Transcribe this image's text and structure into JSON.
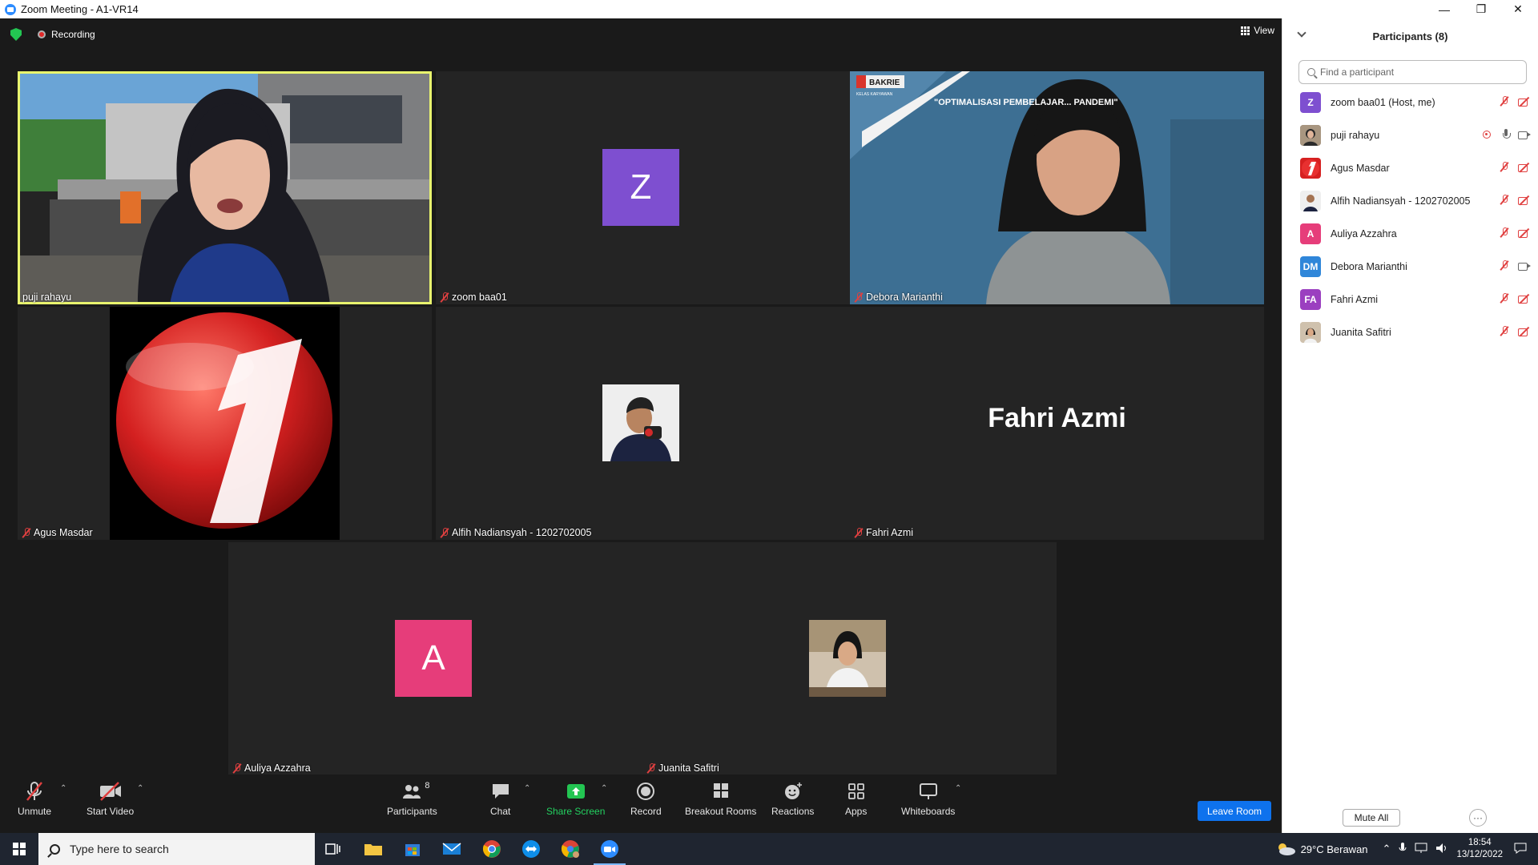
{
  "window": {
    "title": "Zoom Meeting - A1-VR14"
  },
  "meeting": {
    "recording_label": "Recording",
    "view_label": "View"
  },
  "tiles": [
    {
      "name": "puji rahayu"
    },
    {
      "name": "zoom baa01",
      "initial": "Z",
      "color": "#7e4fd0"
    },
    {
      "name": "Debora Marianthi",
      "banner": "\"OPTIMALISASI PEMBELAJAR... PANDEMI\"",
      "logo": "BAKRIE",
      "logo_sub": "KELAS KARYAWAN"
    },
    {
      "name": "Agus Masdar"
    },
    {
      "name": "Alfih Nadiansyah - 1202702005"
    },
    {
      "name": "Fahri Azmi",
      "display_name": "Fahri Azmi"
    },
    {
      "name": "Auliya Azzahra",
      "initial": "A",
      "color": "#e63d7a"
    },
    {
      "name": "Juanita Safitri"
    }
  ],
  "toolbar": {
    "unmute": "Unmute",
    "start_video": "Start Video",
    "participants": "Participants",
    "participants_count": "8",
    "chat": "Chat",
    "share_screen": "Share Screen",
    "record": "Record",
    "breakout_rooms": "Breakout Rooms",
    "reactions": "Reactions",
    "apps": "Apps",
    "whiteboards": "Whiteboards",
    "leave_room": "Leave Room"
  },
  "panel": {
    "title": "Participants (8)",
    "search_placeholder": "Find a participant",
    "participants": [
      {
        "name": "zoom baa01 (Host, me)",
        "initials": "Z",
        "color": "#7e4fd0"
      },
      {
        "name": "puji rahayu",
        "initials": "",
        "color": "#7a6a5a"
      },
      {
        "name": "Agus Masdar",
        "initials": "",
        "color": "#d62020"
      },
      {
        "name": "Alfih Nadiansyah - 1202702005",
        "initials": "",
        "color": "#c9b7a4"
      },
      {
        "name": "Auliya Azzahra",
        "initials": "A",
        "color": "#e63d7a"
      },
      {
        "name": "Debora Marianthi",
        "initials": "DM",
        "color": "#2f86d9"
      },
      {
        "name": "Fahri Azmi",
        "initials": "FA",
        "color": "#9b3fc0"
      },
      {
        "name": "Juanita Safitri",
        "initials": "",
        "color": "#c8b29a"
      }
    ],
    "mute_all": "Mute All",
    "more": "···"
  },
  "taskbar": {
    "search_placeholder": "Type here to search",
    "weather": "29°C  Berawan",
    "time": "18:54",
    "date": "13/12/2022"
  }
}
